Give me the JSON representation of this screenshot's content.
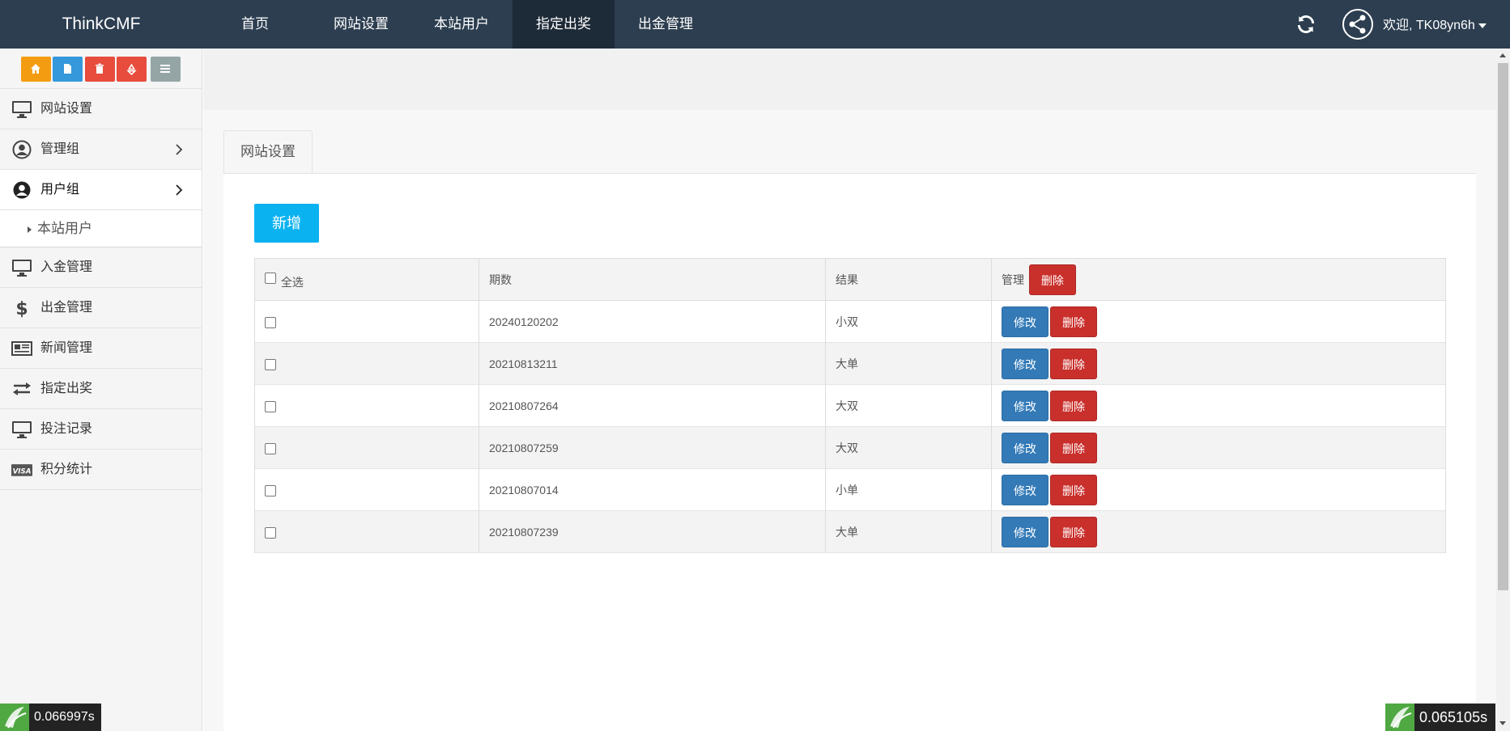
{
  "brand": "ThinkCMF",
  "nav": [
    {
      "label": "首页",
      "active": false
    },
    {
      "label": "网站设置",
      "active": false
    },
    {
      "label": "本站用户",
      "active": false
    },
    {
      "label": "指定出奖",
      "active": true
    },
    {
      "label": "出金管理",
      "active": false
    }
  ],
  "user": {
    "welcome": "欢迎, TK08yn6h"
  },
  "shortcuts": [
    {
      "icon": "home-icon",
      "color": "#f39c12"
    },
    {
      "icon": "file-icon",
      "color": "#3498db"
    },
    {
      "icon": "trash-icon",
      "color": "#e74c3c"
    },
    {
      "icon": "recycle-icon",
      "color": "#e74c3c"
    },
    {
      "icon": "list-icon",
      "color": "#95a5a6"
    }
  ],
  "sidebar": {
    "items": [
      {
        "label": "网站设置",
        "icon": "monitor-icon"
      },
      {
        "label": "管理组",
        "icon": "user-circle-icon"
      },
      {
        "label": "用户组",
        "icon": "user-circle-solid-icon"
      },
      {
        "label": "本站用户"
      },
      {
        "label": "入金管理",
        "icon": "monitor-icon"
      },
      {
        "label": "出金管理",
        "icon": "dollar-icon"
      },
      {
        "label": "新闻管理",
        "icon": "newspaper-icon"
      },
      {
        "label": "指定出奖",
        "icon": "exchange-icon"
      },
      {
        "label": "投注记录",
        "icon": "monitor-icon"
      },
      {
        "label": "积分统计",
        "icon": "visa-icon"
      }
    ]
  },
  "main": {
    "tab": "网站设置",
    "add_button": "新增",
    "table": {
      "headers": {
        "select_all": "全选",
        "period": "期数",
        "result": "结果",
        "manage": "管理"
      },
      "header_delete": "删除",
      "edit_label": "修改",
      "delete_label": "删除",
      "rows": [
        {
          "period": "20240120202",
          "result": "小双"
        },
        {
          "period": "20210813211",
          "result": "大单"
        },
        {
          "period": "20210807264",
          "result": "大双"
        },
        {
          "period": "20210807259",
          "result": "大双"
        },
        {
          "period": "20210807014",
          "result": "小单"
        },
        {
          "period": "20210807239",
          "result": "大单"
        }
      ]
    }
  },
  "trace": {
    "left_time": "0.066997s",
    "right_time": "0.065105s"
  },
  "colors": {
    "topbar": "#2c3e50",
    "add_button": "#0bb2f0",
    "edit": "#337ab7",
    "delete": "#c9302c"
  }
}
